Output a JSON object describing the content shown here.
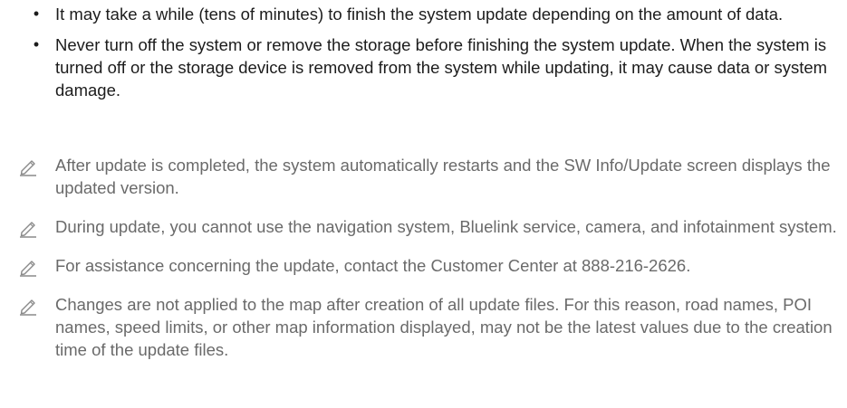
{
  "bullets": [
    {
      "text": "It may take a while (tens of minutes) to finish the system update depending on the amount of data."
    },
    {
      "text": "Never turn off the system or remove the storage before finishing the system update. When the system is turned off or the storage device is removed from the system while updating, it may cause data or system damage."
    }
  ],
  "notes": [
    {
      "icon": "pencil-note-icon",
      "text": "After update is completed, the system automatically restarts and the SW Info/Update screen displays the updated version."
    },
    {
      "icon": "pencil-note-icon",
      "text": "During update, you cannot use the navigation system, Bluelink service, camera, and infotainment system."
    },
    {
      "icon": "pencil-note-icon",
      "text": "For assistance concerning the update, contact the Customer Center at 888-216-2626."
    },
    {
      "icon": "pencil-note-icon",
      "text": "Changes are not applied to the map after creation of all update files. For this reason, road names, POI names, speed limits, or other map information displayed, may not be the latest values due to the creation time of the update files."
    }
  ],
  "colors": {
    "body_text": "#1c1c1c",
    "note_text": "#6a6a6a",
    "icon": "#8a8a8a"
  }
}
